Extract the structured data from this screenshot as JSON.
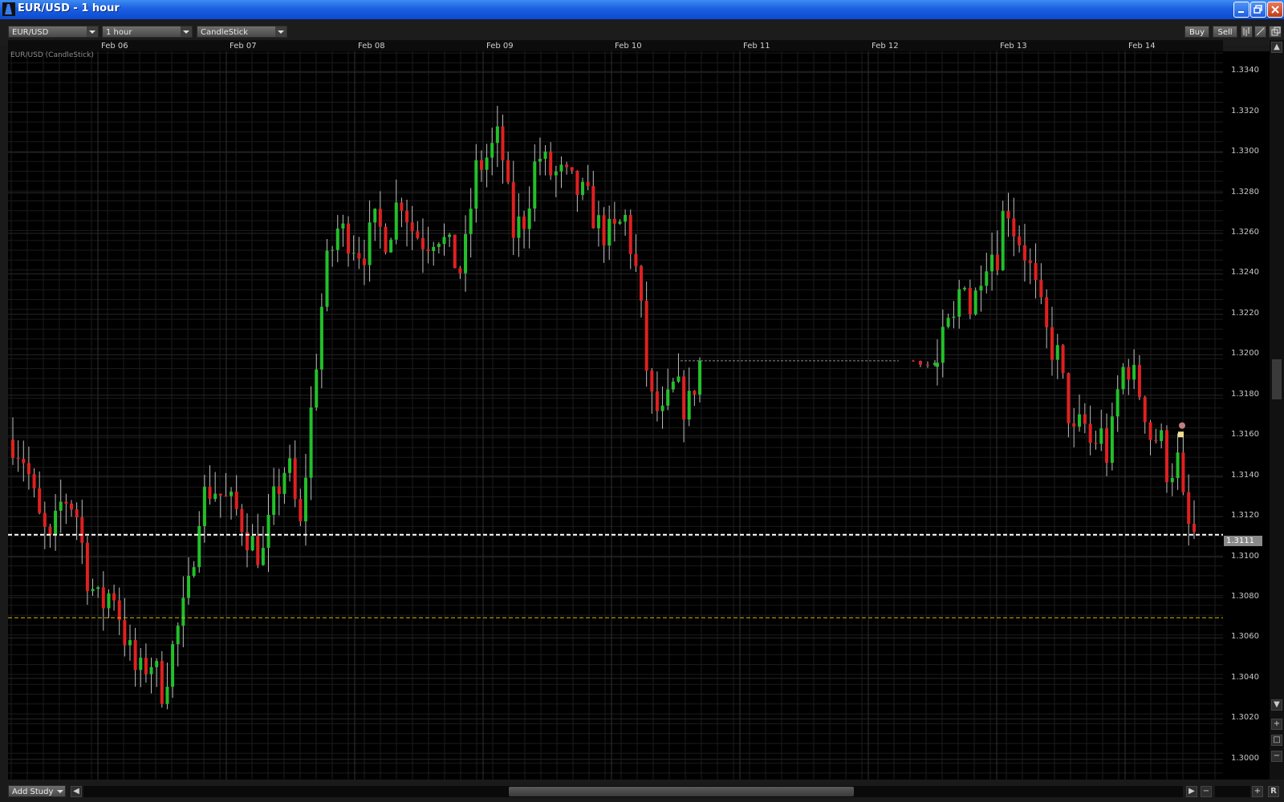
{
  "window": {
    "title": "EUR/USD - 1 hour"
  },
  "toolbar": {
    "symbol": "EUR/USD",
    "interval": "1 hour",
    "chart_type": "CandleStick",
    "buy_label": "Buy",
    "sell_label": "Sell"
  },
  "chart_label": "EUR/USD (CandleStick)",
  "current_price": "1.3111",
  "footer": {
    "add_study_label": "Add Study",
    "r_label": "R"
  },
  "colors": {
    "bull": "#22c02a",
    "bear": "#e02020",
    "price_line": "#ffffff",
    "level_line": "#d6b800"
  },
  "chart_data": {
    "type": "candlestick",
    "x_labels": [
      "Feb 06",
      "Feb 07",
      "Feb 08",
      "Feb 09",
      "Feb 10",
      "Feb 11",
      "Feb 12",
      "Feb 13",
      "Feb 14"
    ],
    "y_ticks": [
      "1.3340",
      "1.3320",
      "1.3300",
      "1.3280",
      "1.3260",
      "1.3240",
      "1.3220",
      "1.3200",
      "1.3180",
      "1.3160",
      "1.3140",
      "1.3120",
      "1.3100",
      "1.3080",
      "1.3060",
      "1.3040",
      "1.3020",
      "1.3000"
    ],
    "ylim": [
      1.299,
      1.335
    ],
    "horizontal_lines": [
      {
        "value": 1.3111,
        "style": "dashed",
        "color": "#ffffff"
      },
      {
        "value": 1.307,
        "style": "dashed",
        "color": "#d6b800"
      }
    ],
    "segments": [
      {
        "anchor": [
          1.3158,
          1.3148,
          1.312,
          1.3105,
          1.313,
          1.3125,
          1.309,
          1.3075,
          1.3085,
          1.306,
          1.304,
          1.305,
          1.3034,
          1.306,
          1.308,
          1.3128,
          1.3135,
          1.3128,
          1.3122,
          1.3108,
          1.31,
          1.313,
          1.3148,
          1.3112,
          1.318,
          1.324,
          1.3262,
          1.3258,
          1.325,
          1.3264,
          1.3258,
          1.328,
          1.3262,
          1.3256,
          1.3262,
          1.325,
          1.324,
          1.329,
          1.3298,
          1.3308,
          1.326,
          1.3268,
          1.33,
          1.329,
          1.3288,
          1.3282,
          1.3276,
          1.3262,
          1.3258,
          1.3268,
          1.3238,
          1.3178,
          1.3168,
          1.3185,
          1.3172,
          1.3196
        ]
      },
      {
        "anchor": [
          1.3197,
          1.3196,
          1.3195,
          1.3196
        ]
      },
      {
        "anchor": [
          1.3194,
          1.3212,
          1.3215,
          1.3245,
          1.3218,
          1.3242,
          1.3252,
          1.325,
          1.3278,
          1.3262,
          1.3254,
          1.324,
          1.3222,
          1.3206,
          1.32,
          1.3178,
          1.3158,
          1.3168,
          1.3154,
          1.3162,
          1.3148,
          1.318,
          1.3198,
          1.3188,
          1.3178,
          1.3158,
          1.316,
          1.314,
          1.315,
          1.3116,
          1.3111
        ]
      }
    ]
  }
}
